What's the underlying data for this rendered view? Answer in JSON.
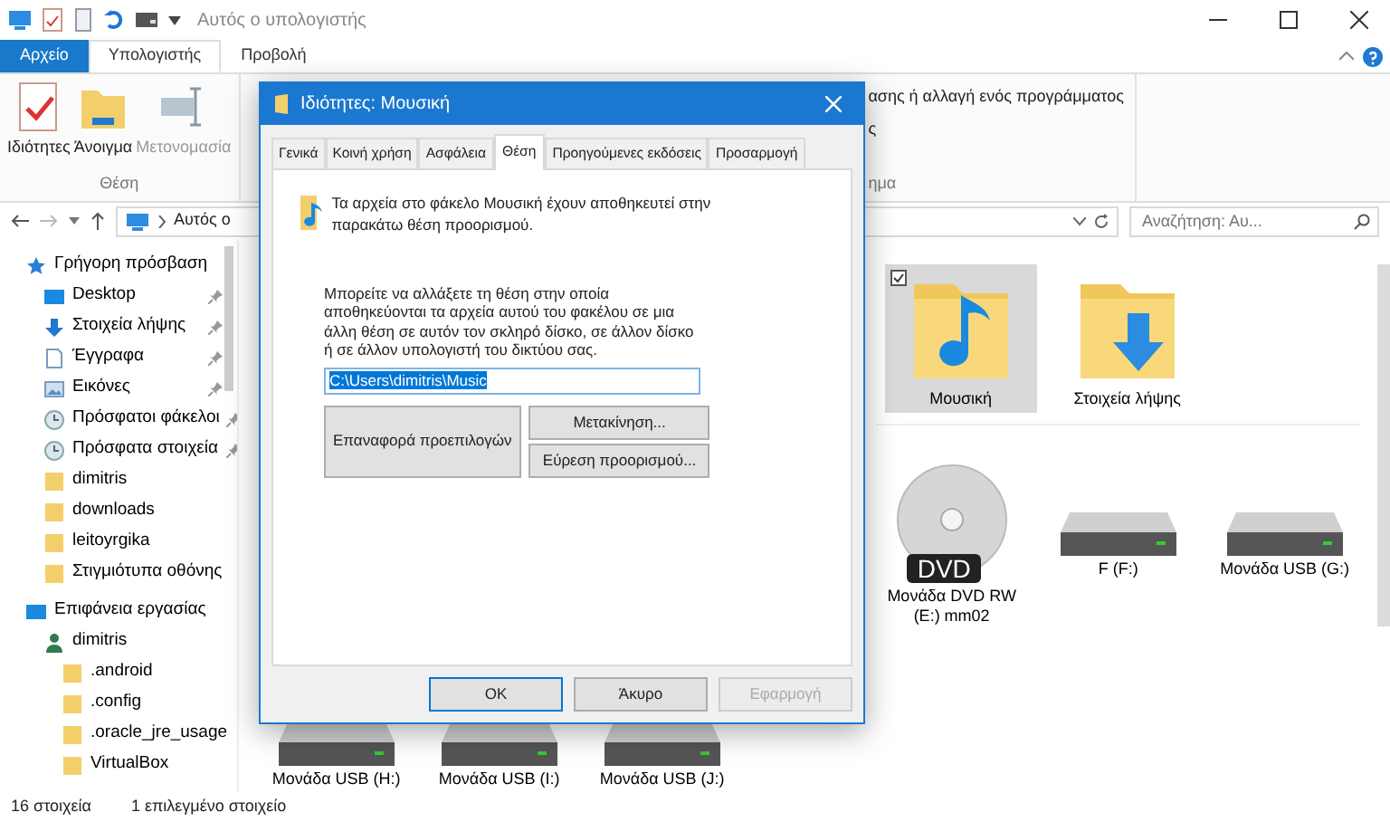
{
  "window": {
    "title": "Αυτός ο υπολογιστής"
  },
  "ribbon_tabs": [
    {
      "label": "Αρχείο",
      "kind": "file",
      "selected": false
    },
    {
      "label": "Υπολογιστής",
      "kind": "tab",
      "selected": true
    },
    {
      "label": "Προβολή",
      "kind": "tab",
      "selected": false
    }
  ],
  "ribbon": {
    "buttons": [
      {
        "label": "Ιδιότητες",
        "kind": "properties",
        "disabled": false
      },
      {
        "label": "Άνοιγμα",
        "kind": "open",
        "disabled": false
      },
      {
        "label": "Μετονομασία",
        "kind": "rename",
        "disabled": true
      }
    ],
    "group_label": "Θέση",
    "partial_lines": [
      "ασης ή αλλαγή ενός προγράμματος",
      "ς"
    ],
    "partial_group_label": "ημα"
  },
  "address_bar": {
    "path": "Αυτός ο"
  },
  "search": {
    "placeholder": "Αναζήτηση: Αυ..."
  },
  "sidebar": {
    "items": [
      {
        "label": "Γρήγορη πρόσβαση",
        "kind": "star",
        "pinned": false,
        "children": [
          {
            "label": "Desktop",
            "kind": "desktop",
            "pinned": true
          },
          {
            "label": "Στοιχεία λήψης",
            "kind": "download",
            "pinned": true
          },
          {
            "label": "Έγγραφα",
            "kind": "documents",
            "pinned": true
          },
          {
            "label": "Εικόνες",
            "kind": "pictures",
            "pinned": true
          },
          {
            "label": "Πρόσφατοι φάκελοι",
            "kind": "recent",
            "pinned": true
          },
          {
            "label": "Πρόσφατα στοιχεία",
            "kind": "recent",
            "pinned": true
          },
          {
            "label": "dimitris",
            "kind": "folder",
            "pinned": false
          },
          {
            "label": "downloads",
            "kind": "folder",
            "pinned": false
          },
          {
            "label": "leitoyrgika",
            "kind": "folder",
            "pinned": false
          },
          {
            "label": "Στιγμιότυπα οθόνης",
            "kind": "folder",
            "pinned": false
          }
        ]
      },
      {
        "label": "Επιφάνεια εργασίας",
        "kind": "desktop",
        "pinned": false,
        "children": [
          {
            "label": "dimitris",
            "kind": "user",
            "pinned": false,
            "children": [
              {
                "label": ".android",
                "kind": "folder",
                "pinned": false
              },
              {
                "label": ".config",
                "kind": "folder",
                "pinned": false
              },
              {
                "label": ".oracle_jre_usage",
                "kind": "folder",
                "pinned": false
              },
              {
                "label": "VirtualBox",
                "kind": "folder",
                "pinned": false
              }
            ]
          }
        ]
      }
    ]
  },
  "content": {
    "folders": [
      {
        "label": "Μουσική",
        "kind": "music",
        "selected": true
      },
      {
        "label": "Στοιχεία λήψης",
        "kind": "download",
        "selected": false
      }
    ],
    "drives": [
      {
        "label": "Μονάδα DVD RW (E:) mm02",
        "kind": "dvd",
        "disc_label": "DVD"
      },
      {
        "label": "F (F:)",
        "kind": "hdd"
      },
      {
        "label": "Μονάδα USB (G:)",
        "kind": "hdd"
      }
    ],
    "drives_lower": [
      {
        "label": "Μονάδα USB (H:)",
        "kind": "hdd"
      },
      {
        "label": "Μονάδα USB (I:)",
        "kind": "hdd"
      },
      {
        "label": "Μονάδα USB (J:)",
        "kind": "hdd"
      }
    ]
  },
  "status_bar": {
    "count": "16 στοιχεία",
    "selection": "1 επιλεγμένο στοιχείο"
  },
  "dialog": {
    "title": "Ιδιότητες: Μουσική",
    "tabs": [
      {
        "label": "Γενικά",
        "selected": false
      },
      {
        "label": "Κοινή χρήση",
        "selected": false
      },
      {
        "label": "Ασφάλεια",
        "selected": false
      },
      {
        "label": "Θέση",
        "selected": true
      },
      {
        "label": "Προηγούμενες εκδόσεις",
        "selected": false
      },
      {
        "label": "Προσαρμογή",
        "selected": false
      }
    ],
    "intro": "Τα αρχεία στο φάκελο Μουσική έχουν αποθηκευτεί στην παρακάτω θέση προορισμού.",
    "description": "Μπορείτε να αλλάξετε τη θέση στην οποία αποθηκεύονται τα αρχεία αυτού του φακέλου σε μια άλλη θέση σε αυτόν τον σκληρό δίσκο, σε άλλον δίσκο ή σε άλλον υπολογιστή του δικτύου σας.",
    "path_value": "C:\\Users\\dimitris\\Music",
    "buttons": [
      {
        "label": "Επαναφορά προεπιλογών"
      },
      {
        "label": "Μετακίνηση..."
      },
      {
        "label": "Εύρεση προορισμού..."
      }
    ],
    "footer_buttons": [
      {
        "label": "OK",
        "default": true,
        "disabled": false
      },
      {
        "label": "Άκυρο",
        "default": false,
        "disabled": false
      },
      {
        "label": "Εφαρμογή",
        "default": false,
        "disabled": true
      }
    ]
  }
}
